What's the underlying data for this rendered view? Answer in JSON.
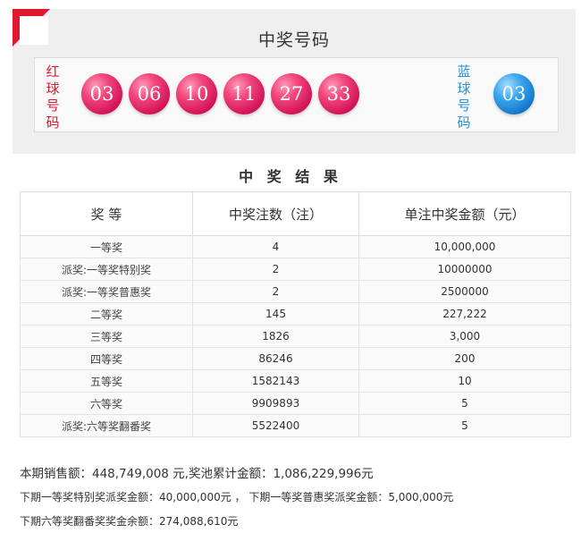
{
  "header": {
    "title": "中奖号码",
    "red_label": "红球号码",
    "blue_label": "蓝球号码"
  },
  "red_balls": [
    "03",
    "06",
    "10",
    "11",
    "27",
    "33"
  ],
  "blue_ball": "03",
  "results": {
    "title": "中 奖 结 果",
    "columns": [
      "奖 等",
      "中奖注数（注）",
      "单注中奖金额（元）"
    ],
    "rows": [
      {
        "level": "一等奖",
        "count": "4",
        "amount": "10,000,000"
      },
      {
        "level": "派奖:一等奖特别奖",
        "count": "2",
        "amount": "10000000"
      },
      {
        "level": "派奖:一等奖普惠奖",
        "count": "2",
        "amount": "2500000"
      },
      {
        "level": "二等奖",
        "count": "145",
        "amount": "227,222"
      },
      {
        "level": "三等奖",
        "count": "1826",
        "amount": "3,000"
      },
      {
        "level": "四等奖",
        "count": "86246",
        "amount": "200"
      },
      {
        "level": "五等奖",
        "count": "1582143",
        "amount": "10"
      },
      {
        "level": "六等奖",
        "count": "9909893",
        "amount": "5"
      },
      {
        "level": "派奖:六等奖翻番奖",
        "count": "5522400",
        "amount": "5"
      }
    ]
  },
  "footer": {
    "line1": "本期销售额：448,749,008 元,奖池累计金额：1,086,229,996元",
    "line2": "下期一等奖特别奖派奖金额：40,000,000元 ， 下期一等奖普惠奖派奖金额：5,000,000元",
    "line3": "下期六等奖翻番奖奖金余额：274,088,610元"
  },
  "colors": {
    "accent_red": "#e0192e",
    "red_ball": "#d4145a",
    "blue_ball": "#1476c8",
    "blue_label": "#2a90d8"
  }
}
